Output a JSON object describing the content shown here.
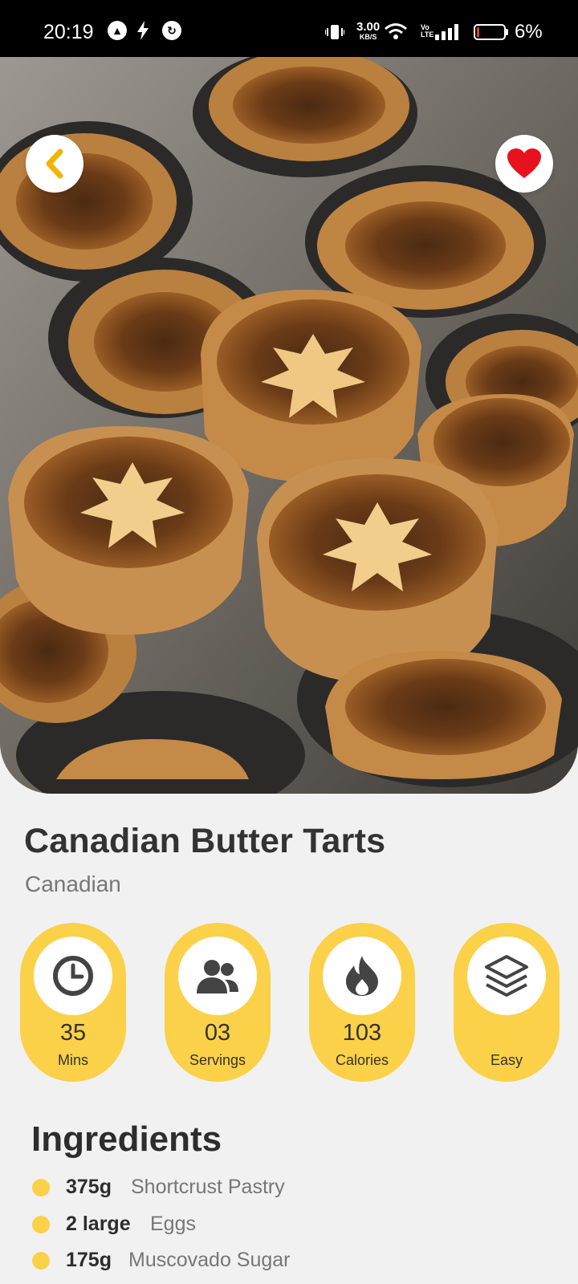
{
  "status_bar": {
    "time": "20:19",
    "notification_icons": [
      "app-a-icon",
      "charging-bolt-icon",
      "sync-icon"
    ],
    "net_speed_value": "3.00",
    "net_speed_unit": "KB/S",
    "volte": "Vo LTE",
    "battery_percent": "6%",
    "battery_level": 0.06
  },
  "hero": {
    "image_subject": "butter tarts in a muffin tin",
    "back_icon": "chevron-left-icon",
    "favorite_icon": "heart-icon",
    "favorite_active": true
  },
  "recipe": {
    "title": "Canadian Butter Tarts",
    "cuisine": "Canadian"
  },
  "stats": [
    {
      "icon": "clock-icon",
      "value": "35",
      "label": "Mins"
    },
    {
      "icon": "people-icon",
      "value": "03",
      "label": "Servings"
    },
    {
      "icon": "flame-icon",
      "value": "103",
      "label": "Calories"
    },
    {
      "icon": "layers-icon",
      "value": "",
      "label": "Easy"
    }
  ],
  "ingredients": {
    "heading": "Ingredients",
    "items": [
      {
        "qty": "375g",
        "name": "Shortcrust Pastry"
      },
      {
        "qty": "2 large",
        "name": "Eggs"
      },
      {
        "qty": "175g",
        "name": "Muscovado Sugar"
      }
    ]
  },
  "colors": {
    "accent": "#fbd149",
    "favorite": "#e8121f",
    "back_arrow": "#f4b400",
    "text_dark": "#333333",
    "text_muted": "#777777",
    "background": "#f1f1f1"
  }
}
